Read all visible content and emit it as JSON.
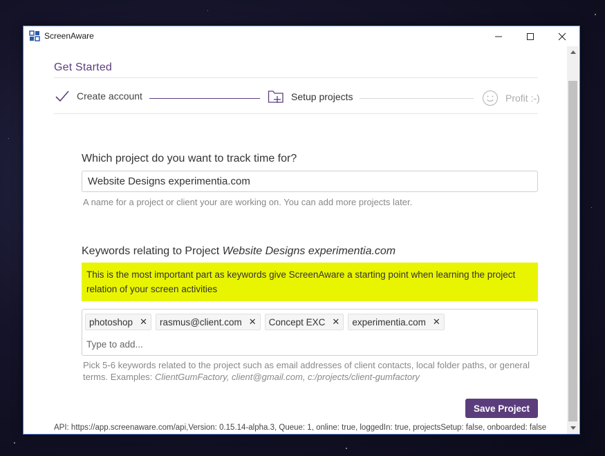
{
  "window": {
    "title": "ScreenAware"
  },
  "page": {
    "title": "Get Started"
  },
  "steps": [
    {
      "label": "Create account"
    },
    {
      "label": "Setup projects"
    },
    {
      "label": "Profit :-)"
    }
  ],
  "project": {
    "question": "Which project do you want to track time for?",
    "value": "Website Designs experimentia.com",
    "hint": "A name for a project or client your are working on. You can add more projects later."
  },
  "keywords": {
    "label_prefix": "Keywords relating to Project",
    "label_project": "Website Designs experimentia.com",
    "callout": "This is the most important part as keywords give ScreenAware a starting point when learning the project relation of your screen activities",
    "tags": [
      "photoshop",
      "rasmus@client.com",
      "Concept EXC",
      "experimentia.com"
    ],
    "input_placeholder": "Type to add...",
    "hint_text": "Pick 5-6 keywords related to the project such as email addresses of client contacts, local folder paths, or general terms. Examples:",
    "hint_examples": "ClientGumFactory, client@gmail.com, c:/projects/client-gumfactory"
  },
  "actions": {
    "save_label": "Save Project"
  },
  "status": "API: https://app.screenaware.com/api,Version: 0.15.14-alpha.3, Queue: 1, online: true, loggedIn: true, projectsSetup: false, onboarded: false",
  "colors": {
    "brand": "#5b3d7c",
    "highlight": "#e9f500"
  },
  "icons": [
    "app-logo-icon",
    "minimize-icon",
    "maximize-icon",
    "close-icon",
    "checkmark-icon",
    "folder-add-icon",
    "smiley-icon",
    "tag-remove-icon"
  ]
}
